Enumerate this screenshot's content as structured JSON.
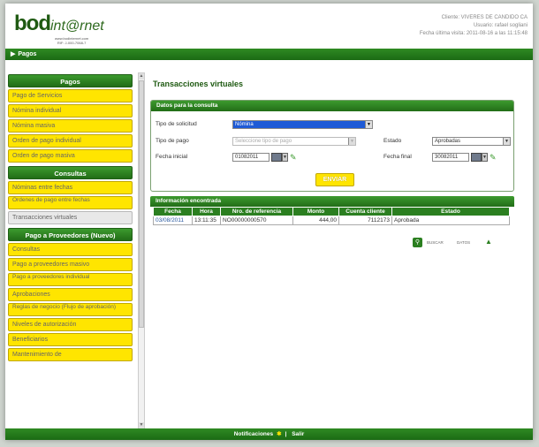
{
  "header": {
    "logo_main": "bod",
    "logo_sub": "int@rnet",
    "logo_url": "www.bodinternet.com",
    "logo_tel": "RIF: J-000-7068-7",
    "client": "Cliente: VIVERES DE CANDIDO CA",
    "user": "Usuario: rafael sogliani",
    "last_visit": "Fecha última visita: 2011-08-16 a las 11:15:48"
  },
  "breadcrumb": {
    "label": "Pagos"
  },
  "sidebar": {
    "sections": [
      {
        "title": "Pagos",
        "items": [
          "Pago de Servicios",
          "Nómina individual",
          "Nómina masiva",
          "Orden de pago individual",
          "Orden de pago masiva"
        ]
      },
      {
        "title": "Consultas",
        "items": [
          "Nóminas entre fechas",
          "Órdenes de pago entre fechas",
          "Transacciones virtuales"
        ]
      },
      {
        "title": "Pago a Proveedores (Nuevo)",
        "items": [
          "Consultas",
          "Pago a proveedores masivo",
          "Pago a proveedores individual",
          "Aprobaciones",
          "Reglas de negocio (Flujo de aprobación)",
          "Niveles de autorización",
          "Beneficiarios",
          "Mantenimiento de"
        ]
      }
    ]
  },
  "main": {
    "title": "Transacciones virtuales",
    "form": {
      "header": "Datos para la consulta",
      "tipo_solicitud_label": "Tipo de solicitud",
      "tipo_solicitud_value": "Nómina",
      "tipo_pago_label": "Tipo de pago",
      "tipo_pago_placeholder": "Seleccione tipo de pago",
      "estado_label": "Estado",
      "estado_value": "Aprobadas",
      "fecha_inicial_label": "Fecha inicial",
      "fecha_inicial_value": "01082011",
      "fecha_final_label": "Fecha final",
      "fecha_final_value": "30082011",
      "submit_label": "ENVIAR"
    },
    "results": {
      "header": "Información encontrada",
      "columns": [
        "Fecha",
        "Hora",
        "Nro. de referencia",
        "Monto",
        "Cuenta cliente",
        "Estado"
      ],
      "rows": [
        [
          "03/08/2011",
          "13:11:35",
          "NO00000000570",
          "444,00",
          "7112173",
          "Aprobada"
        ]
      ],
      "search_label": "BUSCAR",
      "data_label": "DATOS"
    }
  },
  "footer": {
    "notifications": "Notificaciones",
    "separator": "|",
    "logout": "Salir"
  }
}
